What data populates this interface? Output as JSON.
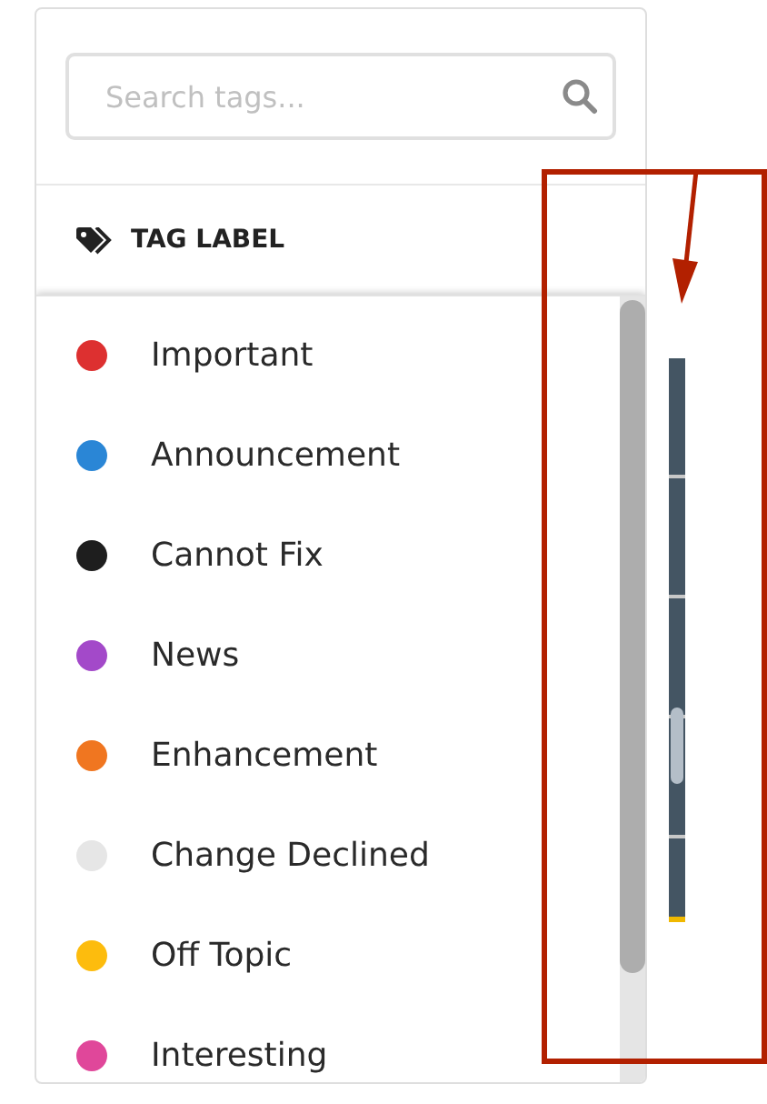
{
  "search": {
    "placeholder": "Search tags..."
  },
  "section": {
    "title": "TAG LABEL"
  },
  "tags": [
    {
      "label": "Important",
      "color": "#dd3030"
    },
    {
      "label": "Announcement",
      "color": "#2a86d6"
    },
    {
      "label": "Cannot Fix",
      "color": "#1e1e1e"
    },
    {
      "label": "News",
      "color": "#a349c9"
    },
    {
      "label": "Enhancement",
      "color": "#f07620"
    },
    {
      "label": "Change Declined",
      "color": "#e6e6e6"
    },
    {
      "label": "Off Topic",
      "color": "#fdbc0d"
    },
    {
      "label": "Interesting",
      "color": "#e0479a"
    }
  ]
}
